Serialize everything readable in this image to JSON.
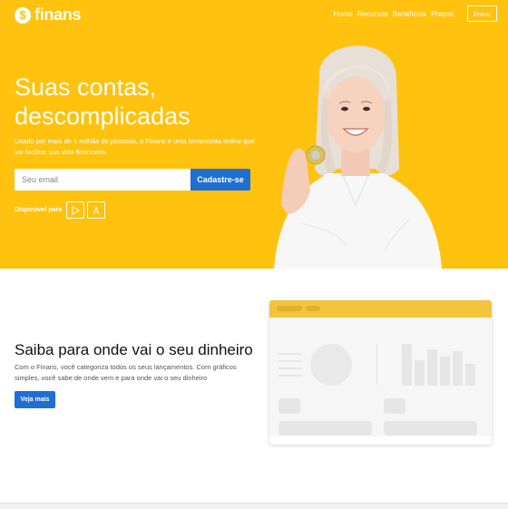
{
  "brand": {
    "name": "finans",
    "symbol": "$"
  },
  "nav": {
    "items": [
      "Home",
      "Recursos",
      "Benefícios",
      "Preços"
    ],
    "cta": "Entrar"
  },
  "hero": {
    "title": "Suas contas, descomplicadas",
    "subtitle": "Usado por mais de 1 milhão de pessoas, o Finans é uma ferramenta online que vai facilitar sua vida financeira.",
    "email_placeholder": "Seu email",
    "signup_label": "Cadastre-se",
    "available_label": "Disponível para",
    "stores": [
      "google-play-icon",
      "app-store-icon"
    ]
  },
  "feature": {
    "title": "Saiba para onde vai o seu dinheiro",
    "text": "Com o Finans, você categoriza todos os seus lançamentos. Com gráficos simples, você sabe de onde vem e para onde vai o seu dinheiro",
    "button_label": "Veja mais"
  },
  "colors": {
    "primary": "#ffc20e",
    "accent": "#1f6fd1",
    "text": "#111111"
  }
}
